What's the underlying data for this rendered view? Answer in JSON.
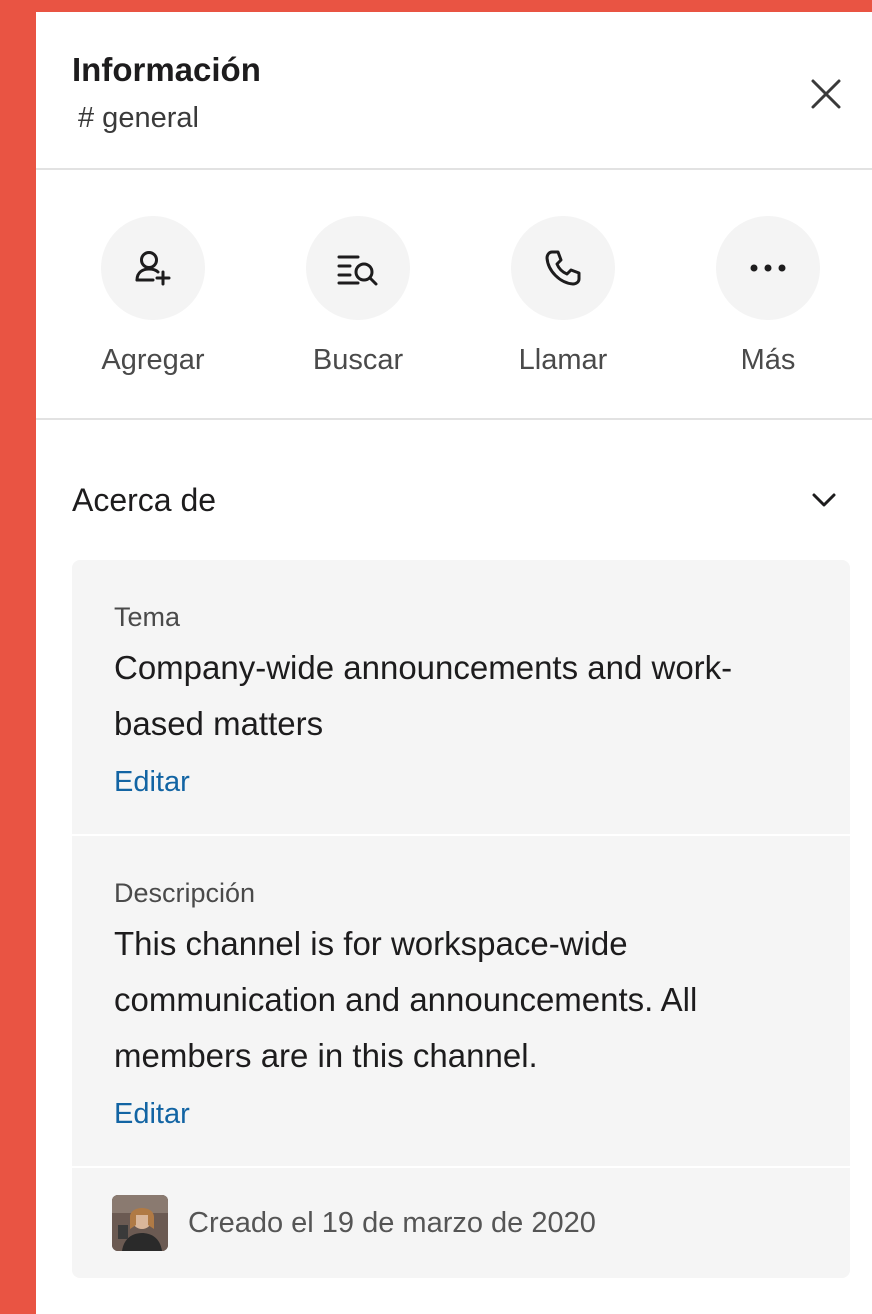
{
  "header": {
    "title": "Información",
    "channel": "# general"
  },
  "actions": [
    {
      "label": "Agregar",
      "icon": "add-person-icon"
    },
    {
      "label": "Buscar",
      "icon": "search-list-icon"
    },
    {
      "label": "Llamar",
      "icon": "phone-icon"
    },
    {
      "label": "Más",
      "icon": "more-icon"
    }
  ],
  "about": {
    "title": "Acerca de",
    "topic": {
      "label": "Tema",
      "value": "Company-wide announcements and work-based matters",
      "edit": "Editar"
    },
    "description": {
      "label": "Descripción",
      "value": "This channel is for workspace-wide communication and announcements. All members are in this channel.",
      "edit": "Editar"
    },
    "created": "Creado el 19 de marzo de 2020"
  },
  "colors": {
    "background": "#E95443",
    "link": "#1264a3"
  }
}
